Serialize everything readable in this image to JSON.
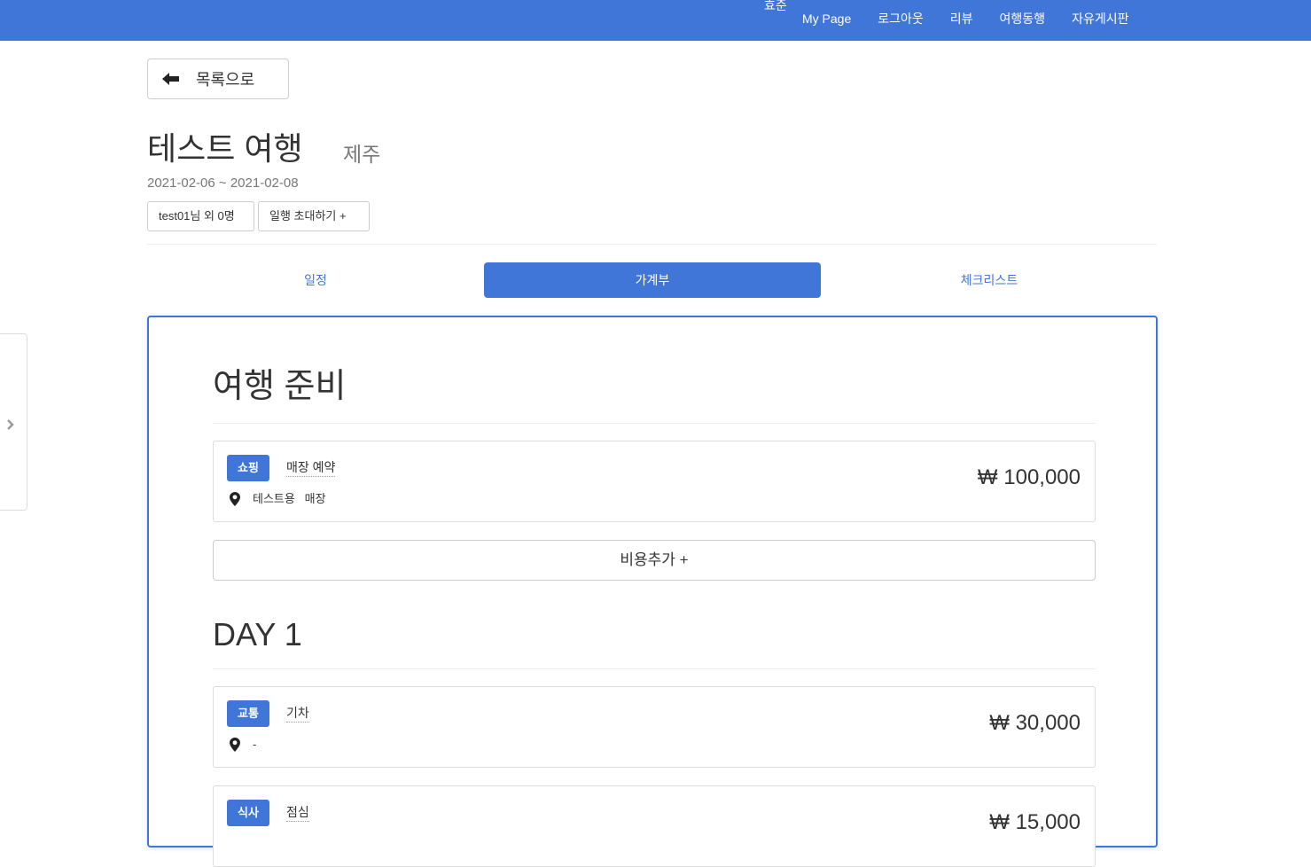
{
  "nav": {
    "user_label": "효준",
    "links": [
      "My Page",
      "로그아웃",
      "리뷰",
      "여행동행",
      "자유게시판"
    ],
    "color": "#4176d9"
  },
  "back_button": {
    "label": "목록으로",
    "icon": "arrow-left-icon"
  },
  "trip": {
    "title": "테스트 여행",
    "region": "제주",
    "dates": "2021-02-06 ~ 2021-02-08",
    "members_label": "test01님 외 0명",
    "invite_label": "일행 초대하기 +"
  },
  "tabs": [
    {
      "label": "일정",
      "active": false
    },
    {
      "label": "가계부",
      "active": true
    },
    {
      "label": "체크리스트",
      "active": false
    }
  ],
  "side_handle": {
    "icon": "chevron-right-icon"
  },
  "ledger": {
    "prep": {
      "title": "여행 준비",
      "items": [
        {
          "category": "쇼핑",
          "name": "매장 예약",
          "place": "테스트용   매장",
          "amount": "₩ 100,000"
        }
      ],
      "add_label": "비용추가 +"
    },
    "days": [
      {
        "title": "DAY 1",
        "items": [
          {
            "category": "교통",
            "name": "기차",
            "place": "-",
            "amount": "₩ 30,000"
          },
          {
            "category": "식사",
            "name": "점심",
            "place": "",
            "amount": "₩ 15,000"
          }
        ]
      }
    ]
  }
}
